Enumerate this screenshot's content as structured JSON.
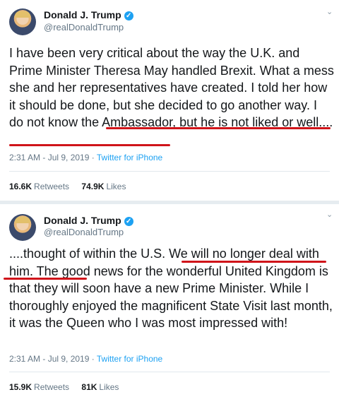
{
  "tweets": [
    {
      "name": "Donald J. Trump",
      "handle": "@realDonaldTrump",
      "text": "I have been very critical about the way the U.K. and Prime Minister Theresa May handled Brexit. What a mess she and her representatives have created. I told her how it should be done, but she decided to go another way. I do not know the Ambassador, but he is not liked or well....",
      "time": "2:31 AM - Jul 9, 2019 · ",
      "source": "Twitter for iPhone",
      "retweets_count": "16.6K",
      "retweets_label": "Retweets",
      "likes_count": "74.9K",
      "likes_label": "Likes"
    },
    {
      "name": "Donald J. Trump",
      "handle": "@realDonaldTrump",
      "text": "....thought of within the U.S. We will no longer deal with him. The good news for the wonderful United Kingdom is that they will soon have a new Prime Minister. While I thoroughly enjoyed the magnificent State Visit last month, it was the Queen who I was most impressed with!",
      "time": "2:31 AM - Jul 9, 2019 · ",
      "source": "Twitter for iPhone",
      "retweets_count": "15.9K",
      "retweets_label": "Retweets",
      "likes_count": "81K",
      "likes_label": "Likes"
    }
  ],
  "icons": {
    "verified": "verified-badge-icon",
    "chevron": "chevron-down-icon",
    "checkmark_glyph": "✓",
    "chevron_glyph": "⌄"
  },
  "colors": {
    "underline": "#d0141a",
    "link": "#1da1f2",
    "verified": "#1da1f2"
  }
}
